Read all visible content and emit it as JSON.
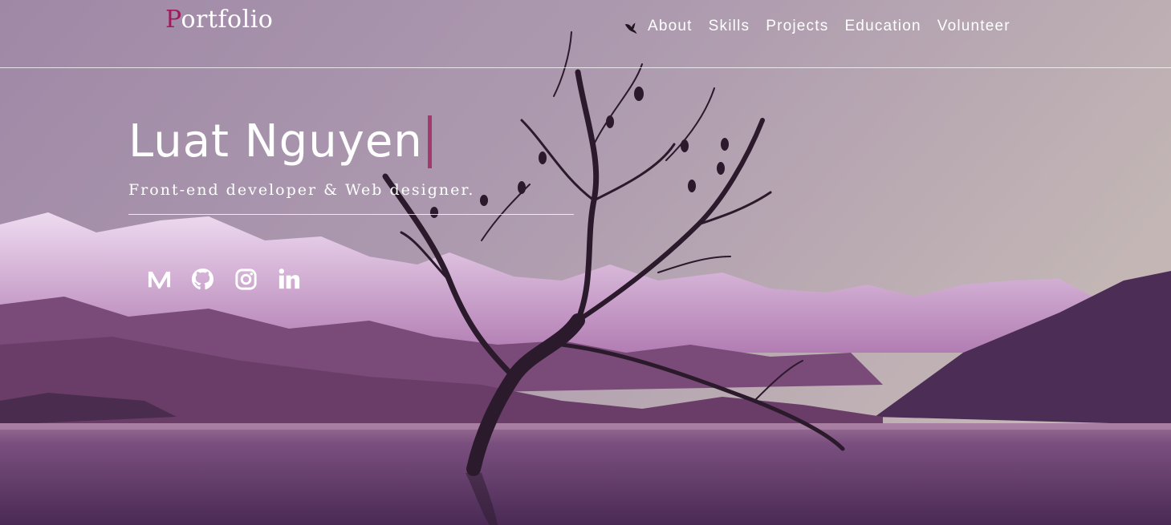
{
  "logo": {
    "first_letter": "P",
    "rest": "ortfolio"
  },
  "nav": {
    "items": [
      {
        "label": "About"
      },
      {
        "label": "Skills"
      },
      {
        "label": "Projects"
      },
      {
        "label": "Education"
      },
      {
        "label": "Volunteer"
      }
    ]
  },
  "hero": {
    "name": "Luat Nguyen",
    "subtitle": "Front-end developer & Web designer."
  },
  "social": {
    "icons": [
      "medium-icon",
      "github-icon",
      "instagram-icon",
      "linkedin-icon"
    ]
  },
  "colors": {
    "accent": "#a0195c",
    "cursor": "#a23a6e",
    "sky_top": "#a68fab",
    "water": "#5e3a63"
  }
}
